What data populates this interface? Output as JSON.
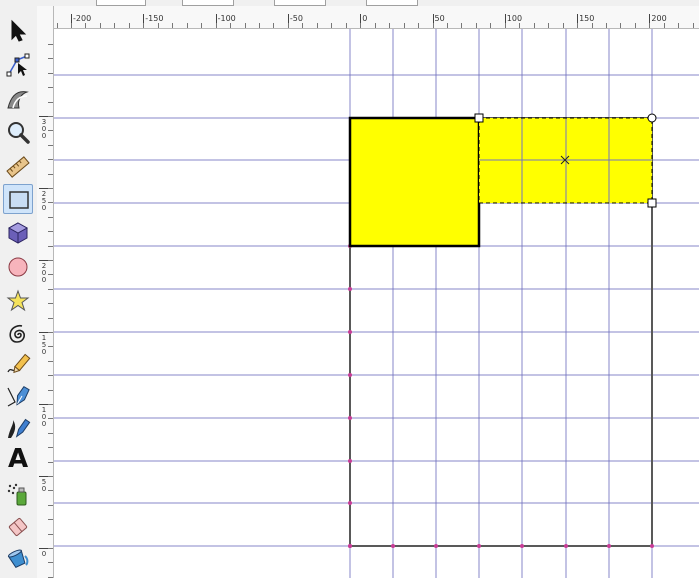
{
  "window": {
    "app": "Inkscape"
  },
  "toolbox": {
    "tools": [
      {
        "name": "selector-tool",
        "icon": "arrow-icon"
      },
      {
        "name": "node-tool",
        "icon": "node-edit-icon"
      },
      {
        "name": "tweak-tool",
        "icon": "tweak-wave-icon"
      },
      {
        "name": "zoom-tool",
        "icon": "magnifier-icon"
      },
      {
        "name": "measure-tool",
        "icon": "ruler-icon"
      },
      {
        "name": "rectangle-tool",
        "icon": "rectangle-icon",
        "active": true
      },
      {
        "name": "3d-box-tool",
        "icon": "cube-icon"
      },
      {
        "name": "ellipse-tool",
        "icon": "circle-icon"
      },
      {
        "name": "star-tool",
        "icon": "star-icon"
      },
      {
        "name": "spiral-tool",
        "icon": "spiral-icon"
      },
      {
        "name": "pencil-tool",
        "icon": "pencil-icon"
      },
      {
        "name": "pen-tool",
        "icon": "pen-nib-icon"
      },
      {
        "name": "calligraphy-tool",
        "icon": "calligraphy-icon"
      },
      {
        "name": "text-tool",
        "icon": "text-a-icon",
        "glyph": "A"
      },
      {
        "name": "spray-tool",
        "icon": "spray-can-icon"
      },
      {
        "name": "eraser-tool",
        "icon": "eraser-icon"
      },
      {
        "name": "paint-bucket-tool",
        "icon": "paint-bucket-icon"
      }
    ]
  },
  "rulers": {
    "horizontal_labels": [
      "-200",
      "-150",
      "-100",
      "-50",
      "0",
      "50",
      "100",
      "150",
      "200"
    ],
    "vertical_labels": [
      "300",
      "250",
      "200",
      "150",
      "100",
      "50",
      "0"
    ]
  },
  "colors": {
    "fill_yellow": "#ffff00",
    "grid_line": "#7373c0",
    "guide_point": "#c83c96",
    "page_border": "#595959",
    "selection_handle": "#000000"
  }
}
